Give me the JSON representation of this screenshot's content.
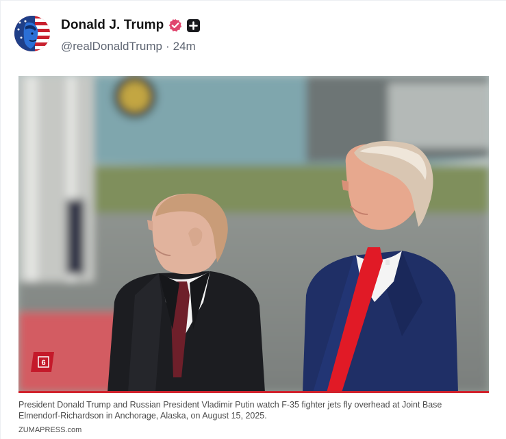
{
  "post": {
    "author": {
      "display_name": "Donald J. Trump",
      "handle": "@realDonaldTrump",
      "separator": "·",
      "timestamp": "24m",
      "verified_badge": "verified-badge-icon",
      "extra_badge": "plus-badge-icon"
    },
    "media": {
      "overlay_badge": "6",
      "caption": "President Donald Trump and Russian President Vladimir Putin watch F-35 fighter jets fly overhead at Joint Base Elmendorf-Richardson in Anchorage, Alaska, on August 15, 2025.",
      "credit": "ZUMAPRESS.com"
    }
  },
  "colors": {
    "verified": "#e0456e",
    "badge_bg": "#17181c",
    "caption_rule": "#d1232d",
    "handle_text": "#5f6673"
  }
}
